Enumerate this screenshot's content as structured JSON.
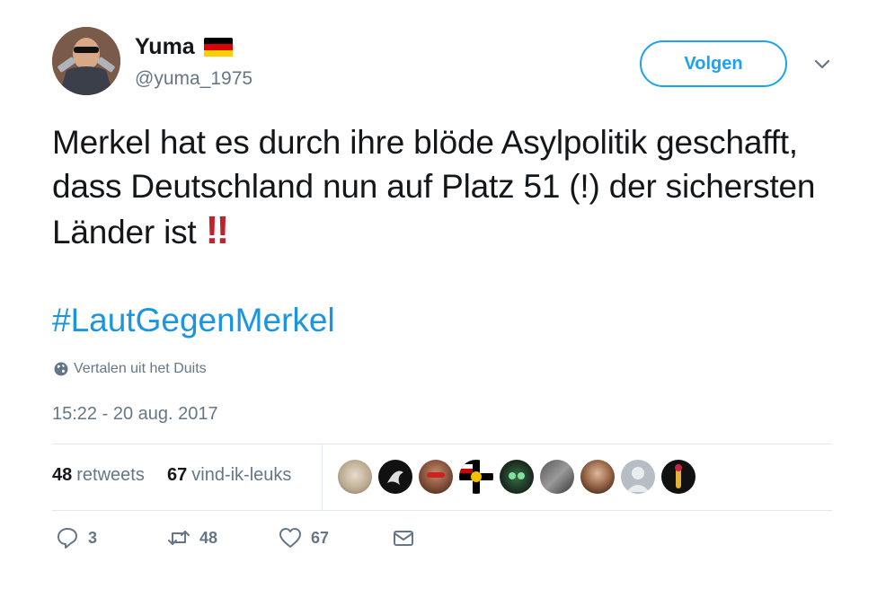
{
  "author": {
    "display_name": "Yuma",
    "handle": "@yuma_1975",
    "flag": "de-flag-icon"
  },
  "header": {
    "follow_label": "Volgen",
    "menu_icon": "chevron-down-icon"
  },
  "tweet": {
    "text": "Merkel hat es durch ihre blöde Asylpolitik geschafft, dass Deutschland nun auf Platz 51 (!) der sichersten Länder ist",
    "emphasis": "‼",
    "hashtag": "#LautGegenMerkel",
    "translate_label": "Vertalen uit het Duits",
    "timestamp": "15:22 - 20 aug. 2017"
  },
  "stats": {
    "retweets_count": "48",
    "retweets_label": "retweets",
    "likes_count": "67",
    "likes_label": "vind-ik-leuks"
  },
  "actions": {
    "reply_count": "3",
    "retweet_count": "48",
    "like_count": "67"
  },
  "colors": {
    "accent": "#1da1f2",
    "link": "#1b95e0",
    "muted": "#657786",
    "border": "#e1e8ed",
    "emoji_red": "#c0232c"
  }
}
